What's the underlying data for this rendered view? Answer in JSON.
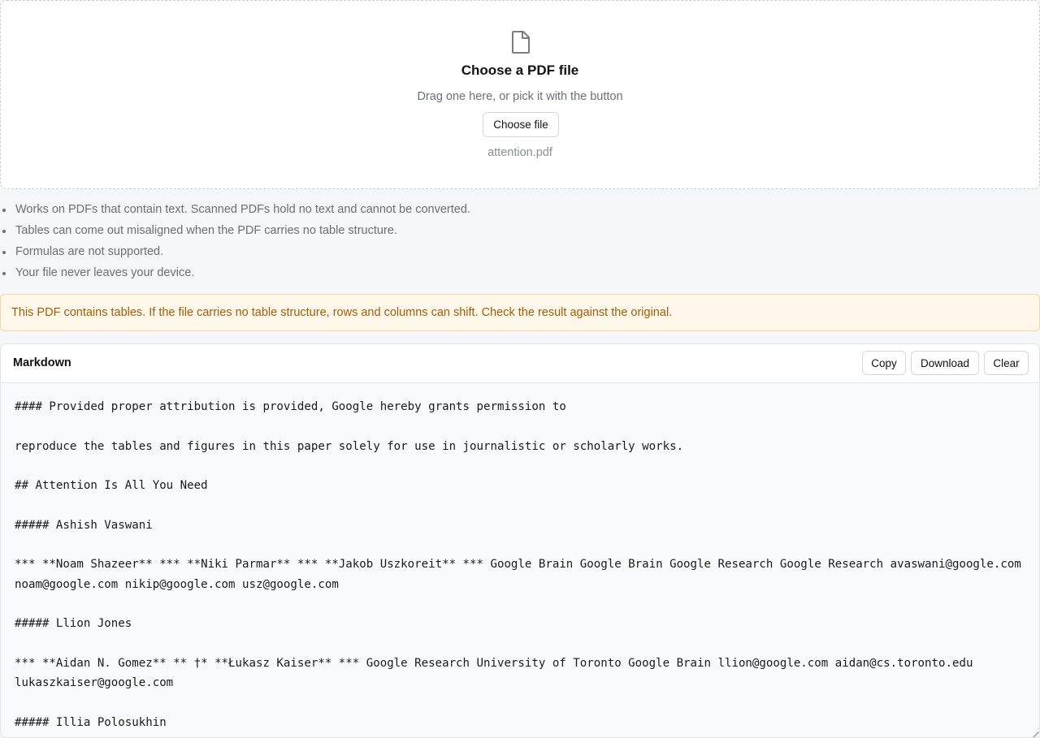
{
  "dropzone": {
    "icon": "file-icon",
    "title": "Choose a PDF file",
    "subtitle": "Drag one here, or pick it with the button",
    "button_label": "Choose file",
    "file_name": "attention.pdf"
  },
  "notes": [
    "Works on PDFs that contain text. Scanned PDFs hold no text and cannot be converted.",
    "Tables can come out misaligned when the PDF carries no table structure.",
    "Formulas are not supported.",
    "Your file never leaves your device."
  ],
  "warning": {
    "text": "This PDF contains tables. If the file carries no table structure, rows and columns can shift. Check the result against the original."
  },
  "output": {
    "title": "Markdown",
    "copy_label": "Copy",
    "download_label": "Download",
    "clear_label": "Clear",
    "content": "#### Provided proper attribution is provided, Google hereby grants permission to\n\nreproduce the tables and figures in this paper solely for use in journalistic or scholarly works.\n\n## Attention Is All You Need\n\n##### Ashish Vaswani\n\n*** **Noam Shazeer** *** **Niki Parmar** *** **Jakob Uszkoreit** *** Google Brain Google Brain Google Research Google Research avaswani@google.com noam@google.com nikip@google.com usz@google.com\n\n##### Llion Jones\n\n*** **Aidan N. Gomez** ** †* **Łukasz Kaiser** *** Google Research University of Toronto Google Brain llion@google.com aidan@cs.toronto.edu lukaszkaiser@google.com\n\n##### Illia Polosukhin"
  },
  "colors": {
    "warning_text": "#a15c07",
    "warning_bg": "#fff8ea",
    "page_bg": "#f5f6f8"
  }
}
